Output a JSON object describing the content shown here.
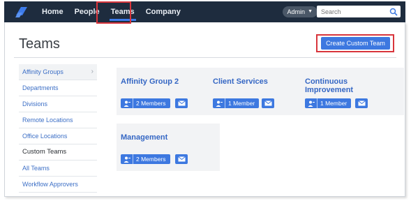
{
  "nav": {
    "items": [
      {
        "label": "Home"
      },
      {
        "label": "People"
      },
      {
        "label": "Teams"
      },
      {
        "label": "Company"
      }
    ],
    "admin_label": "Admin",
    "search_placeholder": "Search"
  },
  "page": {
    "title": "Teams",
    "create_button": "Create Custom Team"
  },
  "sidebar": {
    "items": [
      {
        "label": "Affinity Groups"
      },
      {
        "label": "Departments"
      },
      {
        "label": "Divisions"
      },
      {
        "label": "Remote Locations"
      },
      {
        "label": "Office Locations"
      },
      {
        "label": "Custom Teams"
      },
      {
        "label": "All Teams"
      },
      {
        "label": "Workflow Approvers"
      }
    ]
  },
  "teams": [
    {
      "name": "Affinity Group 2",
      "members": "2 Members"
    },
    {
      "name": "Client Services",
      "members": "1 Member"
    },
    {
      "name": "Continuous Improvement",
      "members": "1 Member"
    },
    {
      "name": "Management",
      "members": "2 Members"
    }
  ],
  "colors": {
    "accent": "#3d78e0",
    "nav_bg": "#1e2c3e",
    "highlight": "#d8353c"
  }
}
